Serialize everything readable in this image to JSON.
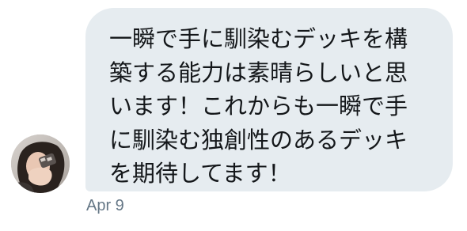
{
  "conversation": {
    "message": {
      "text": "一瞬で手に馴染むデッキを構築する能力は素晴らしいと思います！これからも一瞬で手に馴染む独創性のあるデッキを期待してます！",
      "timestamp": "Apr 9"
    },
    "avatar_icon": "user-avatar-photo"
  },
  "colors": {
    "bubble_background": "#e6ecf0",
    "text": "#14171a",
    "timestamp": "#657786"
  }
}
